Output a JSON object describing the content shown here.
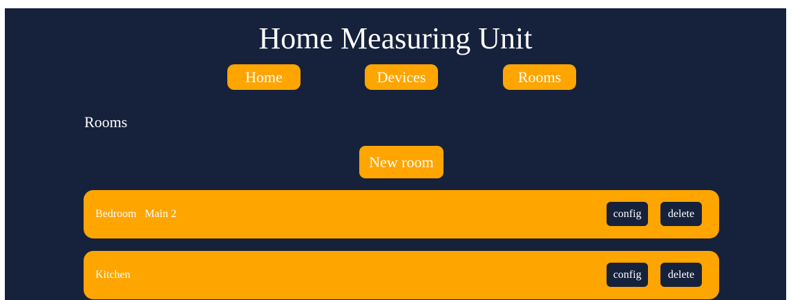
{
  "header": {
    "title": "Home Measuring Unit"
  },
  "nav": {
    "items": [
      {
        "label": "Home"
      },
      {
        "label": "Devices"
      },
      {
        "label": "Rooms"
      }
    ]
  },
  "main": {
    "section_title": "Rooms",
    "new_room_label": "New room",
    "rooms": [
      {
        "name": "Bedroom",
        "extra": "Main 2",
        "config_label": "config",
        "delete_label": "delete"
      },
      {
        "name": "Kitchen",
        "extra": "",
        "config_label": "config",
        "delete_label": "delete"
      }
    ]
  },
  "colors": {
    "background": "#16213c",
    "accent": "#ffa500",
    "text": "#ffffff"
  }
}
